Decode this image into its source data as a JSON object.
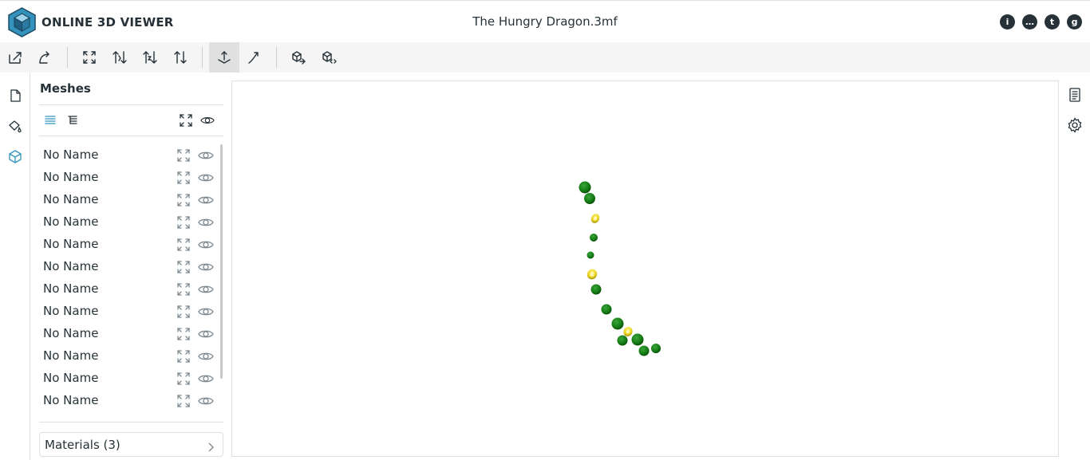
{
  "app": {
    "title": "ONLINE 3D VIEWER",
    "file_name": "The Hungry Dragon.3mf"
  },
  "header_links": [
    {
      "icon": "info-icon",
      "glyph": "i"
    },
    {
      "icon": "chat-icon",
      "glyph": "…"
    },
    {
      "icon": "twitter-icon",
      "glyph": "t"
    },
    {
      "icon": "github-icon",
      "glyph": "g"
    }
  ],
  "toolbar": {
    "items": [
      {
        "icon": "open-file-icon"
      },
      {
        "icon": "open-url-icon"
      },
      {
        "icon": "fit-to-window-icon"
      },
      {
        "icon": "set-up-y-icon"
      },
      {
        "icon": "set-up-z-icon"
      },
      {
        "icon": "flip-up-icon"
      },
      {
        "icon": "fixed-up-vector-icon",
        "selected": true
      },
      {
        "icon": "free-orbit-icon"
      },
      {
        "icon": "export-icon"
      },
      {
        "icon": "share-icon"
      }
    ]
  },
  "left_nav": [
    {
      "icon": "files-icon"
    },
    {
      "icon": "materials-icon"
    },
    {
      "icon": "meshes-icon",
      "active": true
    }
  ],
  "mesh_panel": {
    "title": "Meshes",
    "list_view_icon": "flat-list-icon",
    "tree_view_icon": "tree-view-icon",
    "meshes": [
      "No Name",
      "No Name",
      "No Name",
      "No Name",
      "No Name",
      "No Name",
      "No Name",
      "No Name",
      "No Name",
      "No Name",
      "No Name",
      "No Name"
    ],
    "materials_label": "Materials (3)"
  },
  "right_nav": [
    {
      "icon": "details-icon"
    },
    {
      "icon": "settings-icon"
    }
  ],
  "colors": {
    "accent": "#3393bd",
    "mesh_green": "#137a13",
    "mesh_yellow": "#e8d21c",
    "toolbar_bg": "#f5f5f5"
  }
}
